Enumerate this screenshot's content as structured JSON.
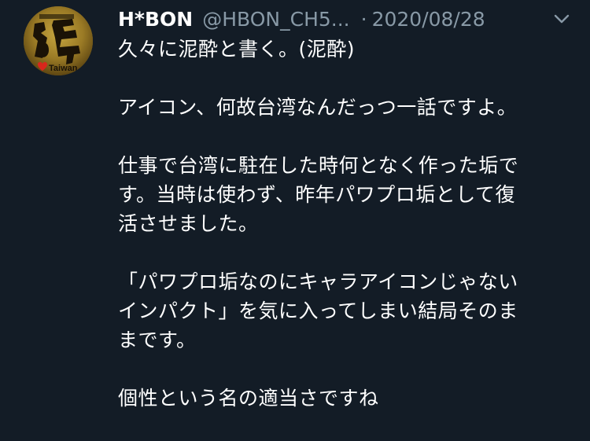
{
  "tweet": {
    "display_name": "H*BON",
    "handle": "@HBON_CH5...",
    "separator": "·",
    "date": "2020/08/28",
    "avatar": {
      "text": "台湾",
      "caption": "Taiwan",
      "heart_color": "#d9261c",
      "icon": "avatar-image"
    },
    "menu_icon": "chevron-down-icon",
    "body": {
      "p1": [
        "久々に泥酔と書く。(泥酔)"
      ],
      "p2": [
        "アイコン、何故台湾なんだっつ一話ですよ。"
      ],
      "p3": [
        "仕事で台湾に駐在した時何となく作った垢で",
        "す。当時は使わず、昨年パワプロ垢として復",
        "活させました。"
      ],
      "p4": [
        "「パワプロ垢なのにキャラアイコンじゃない",
        "インパクト」を気に入ってしまい結局そのま",
        "まです。"
      ],
      "p5": [
        "個性という名の適当さですね"
      ]
    }
  },
  "colors": {
    "background": "#131c26",
    "text": "#ffffff",
    "muted": "#8899a6"
  }
}
